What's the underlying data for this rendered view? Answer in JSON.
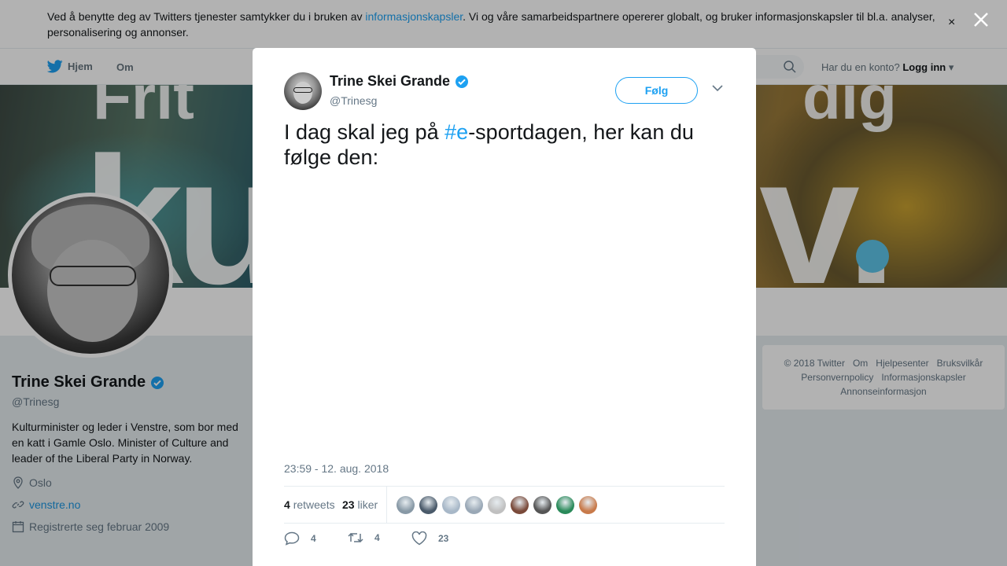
{
  "cookie_bar": {
    "text_before": "Ved å benytte deg av Twitters tjenester samtykker du i bruken av ",
    "link": "informasjonskapsler",
    "text_after": ". Vi og våre samarbeidspartnere opererer globalt, og bruker informasjonskapsler til bl.a. analyser, personalisering og annonser.",
    "close": "×"
  },
  "nav": {
    "home": "Hjem",
    "about": "Om",
    "login_prompt": "Har du en konto?",
    "login": "Logg inn"
  },
  "profile": {
    "name": "Trine Skei Grande",
    "handle": "@Trinesg",
    "bio": "Kulturminister og leder i Venstre, som bor med en katt i Gamle Oslo. Minister of Culture and leader of the Liberal Party in Norway.",
    "location": "Oslo",
    "url": "venstre.no",
    "joined": "Registrerte seg februar 2009"
  },
  "footer": {
    "links": [
      "© 2018 Twitter",
      "Om",
      "Hjelpesenter",
      "Bruksvilkår",
      "Personvernpolicy",
      "Informasjonskapsler",
      "Annonseinformasjon"
    ]
  },
  "tweet": {
    "author_name": "Trine Skei Grande",
    "author_handle": "@Trinesg",
    "follow_label": "Følg",
    "text_before": "I dag skal jeg på ",
    "hashtag": "#e",
    "text_after": "-sportdagen, her kan du følge den:",
    "timestamp": "23:59 - 12. aug. 2018",
    "retweets_count": "4",
    "retweets_label": "retweets",
    "likes_count": "23",
    "likes_label": "liker",
    "reply_count": "4",
    "retweet_action_count": "4",
    "like_action_count": "23"
  },
  "colors": {
    "brand_blue": "#1da1f2",
    "verified_blue": "#1da1f2",
    "muted": "#657786",
    "liker_colors": [
      "#8899a6",
      "#4a5a6a",
      "#a8b8c8",
      "#9aa8b6",
      "#c0c0c0",
      "#7a4a3a",
      "#555555",
      "#2a8a5a",
      "#c87a4a"
    ]
  }
}
